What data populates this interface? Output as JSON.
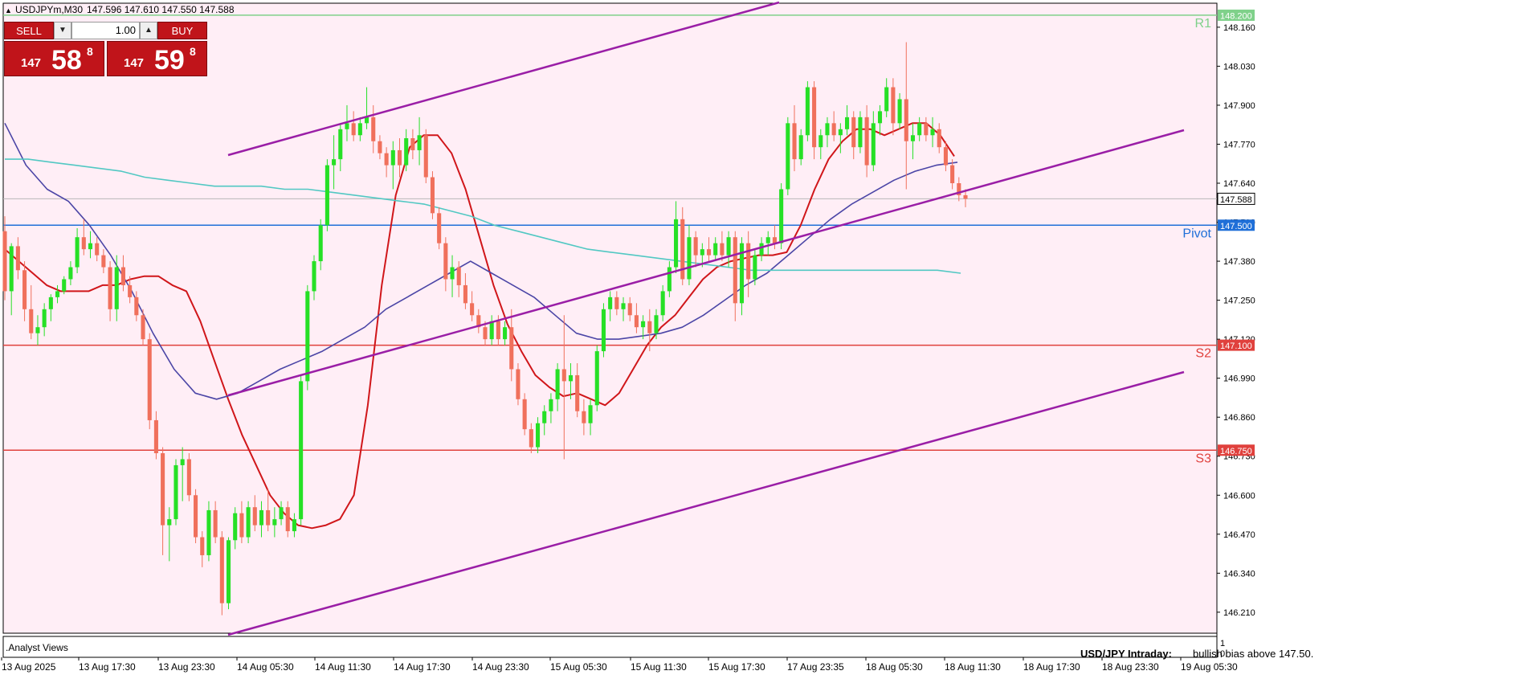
{
  "header": {
    "title": "USDJPYm,M30",
    "ohlc": "147.596 147.610 147.550 147.588"
  },
  "trade_panel": {
    "sell_label": "SELL",
    "buy_label": "BUY",
    "lot_value": "1.00",
    "bid_prefix": "147",
    "bid_big": "58",
    "bid_sup": "8",
    "ask_prefix": "147",
    "ask_big": "59",
    "ask_sup": "8"
  },
  "levels": [
    {
      "name": "R1",
      "price": 148.2,
      "tag": "148.200",
      "color": "#7fd18a"
    },
    {
      "name": "Pivot",
      "price": 147.5,
      "tag": "147.500",
      "color": "#1f6fd8"
    },
    {
      "name": "S2",
      "price": 147.1,
      "tag": "147.100",
      "color": "#e0413d"
    },
    {
      "name": "S3",
      "price": 146.75,
      "tag": "146.750",
      "color": "#e0413d"
    }
  ],
  "current_price": {
    "value": 147.588,
    "tag": "147.588"
  },
  "subpanel": {
    "label": ".Analyst Views",
    "note_bold": "USD/JPY Intraday:",
    "note_text": "bullish bias above 147.50.",
    "scale_top": "1",
    "scale_bottom": "0"
  },
  "colors": {
    "background": "#ffeef6",
    "bull": "#26e026",
    "bear": "#f0705c",
    "ma_fast": "#d0161a",
    "ma_mid": "#4b45a6",
    "ma_slow": "#52c8c3",
    "channel": "#9a1ea6"
  },
  "chart_data": {
    "type": "candlestick",
    "symbol": "USDJPYm",
    "timeframe": "M30",
    "ylim": [
      146.14,
      148.24
    ],
    "yticks": [
      "148.160",
      "148.030",
      "147.900",
      "147.770",
      "147.640",
      "147.510",
      "147.380",
      "147.250",
      "147.120",
      "146.990",
      "146.860",
      "146.730",
      "146.600",
      "146.470",
      "146.340",
      "146.210"
    ],
    "xticks": [
      "13 Aug 2025",
      "13 Aug 17:30",
      "13 Aug 23:30",
      "14 Aug 05:30",
      "14 Aug 11:30",
      "14 Aug 17:30",
      "14 Aug 23:30",
      "15 Aug 05:30",
      "15 Aug 11:30",
      "15 Aug 17:30",
      "17 Aug 23:35",
      "18 Aug 05:30",
      "18 Aug 11:30",
      "18 Aug 17:30",
      "18 Aug 23:30",
      "19 Aug 05:30"
    ],
    "candles": [
      [
        147.48,
        147.53,
        147.25,
        147.28
      ],
      [
        147.28,
        147.44,
        147.2,
        147.43
      ],
      [
        147.43,
        147.46,
        147.32,
        147.35
      ],
      [
        147.35,
        147.38,
        147.18,
        147.22
      ],
      [
        147.22,
        147.3,
        147.12,
        147.14
      ],
      [
        147.14,
        147.2,
        147.1,
        147.16
      ],
      [
        147.16,
        147.24,
        147.13,
        147.22
      ],
      [
        147.22,
        147.27,
        147.18,
        147.26
      ],
      [
        147.26,
        147.3,
        147.24,
        147.28
      ],
      [
        147.28,
        147.33,
        147.27,
        147.32
      ],
      [
        147.32,
        147.38,
        147.3,
        147.36
      ],
      [
        147.36,
        147.49,
        147.34,
        147.46
      ],
      [
        147.46,
        147.52,
        147.4,
        147.42
      ],
      [
        147.42,
        147.48,
        147.39,
        147.44
      ],
      [
        147.44,
        147.46,
        147.38,
        147.4
      ],
      [
        147.4,
        147.42,
        147.34,
        147.36
      ],
      [
        147.36,
        147.38,
        147.18,
        147.22
      ],
      [
        147.22,
        147.4,
        147.18,
        147.36
      ],
      [
        147.36,
        147.4,
        147.28,
        147.3
      ],
      [
        147.3,
        147.33,
        147.24,
        147.26
      ],
      [
        147.26,
        147.28,
        147.18,
        147.2
      ],
      [
        147.2,
        147.22,
        147.1,
        147.12
      ],
      [
        147.12,
        147.14,
        146.82,
        146.85
      ],
      [
        146.85,
        146.88,
        146.72,
        146.74
      ],
      [
        146.74,
        146.76,
        146.4,
        146.5
      ],
      [
        146.5,
        146.56,
        146.38,
        146.52
      ],
      [
        146.52,
        146.72,
        146.5,
        146.7
      ],
      [
        146.7,
        146.76,
        146.58,
        146.72
      ],
      [
        146.72,
        146.74,
        146.58,
        146.6
      ],
      [
        146.6,
        146.62,
        146.44,
        146.46
      ],
      [
        146.46,
        146.48,
        146.36,
        146.4
      ],
      [
        146.4,
        146.58,
        146.38,
        146.55
      ],
      [
        146.55,
        146.58,
        146.44,
        146.46
      ],
      [
        146.46,
        146.48,
        146.2,
        146.24
      ],
      [
        146.24,
        146.46,
        146.22,
        146.45
      ],
      [
        146.45,
        146.56,
        146.42,
        146.54
      ],
      [
        146.54,
        146.58,
        146.44,
        146.46
      ],
      [
        146.46,
        146.58,
        146.44,
        146.56
      ],
      [
        146.56,
        146.6,
        146.48,
        146.5
      ],
      [
        146.5,
        146.58,
        146.46,
        146.55
      ],
      [
        146.55,
        146.62,
        146.48,
        146.5
      ],
      [
        146.5,
        146.56,
        146.46,
        146.52
      ],
      [
        146.52,
        146.58,
        146.5,
        146.56
      ],
      [
        146.56,
        146.58,
        146.46,
        146.48
      ],
      [
        146.48,
        146.54,
        146.46,
        146.52
      ],
      [
        146.52,
        147.0,
        146.5,
        146.98
      ],
      [
        146.98,
        147.3,
        146.95,
        147.28
      ],
      [
        147.28,
        147.4,
        147.25,
        147.38
      ],
      [
        147.38,
        147.52,
        147.35,
        147.5
      ],
      [
        147.5,
        147.72,
        147.48,
        147.7
      ],
      [
        147.7,
        147.8,
        147.62,
        147.72
      ],
      [
        147.72,
        147.84,
        147.68,
        147.82
      ],
      [
        147.82,
        147.9,
        147.78,
        147.84
      ],
      [
        147.84,
        147.88,
        147.78,
        147.8
      ],
      [
        147.8,
        147.86,
        147.78,
        147.84
      ],
      [
        147.84,
        147.96,
        147.82,
        147.86
      ],
      [
        147.86,
        147.9,
        147.74,
        147.78
      ],
      [
        147.78,
        147.8,
        147.72,
        147.74
      ],
      [
        147.74,
        147.76,
        147.66,
        147.7
      ],
      [
        147.7,
        147.78,
        147.62,
        147.75
      ],
      [
        147.75,
        147.79,
        147.66,
        147.7
      ],
      [
        147.7,
        147.82,
        147.68,
        147.79
      ],
      [
        147.79,
        147.82,
        147.72,
        147.75
      ],
      [
        147.75,
        147.86,
        147.7,
        147.8
      ],
      [
        147.8,
        147.82,
        147.64,
        147.66
      ],
      [
        147.66,
        147.68,
        147.52,
        147.54
      ],
      [
        147.54,
        147.56,
        147.42,
        147.44
      ],
      [
        147.44,
        147.46,
        147.28,
        147.32
      ],
      [
        147.32,
        147.4,
        147.26,
        147.36
      ],
      [
        147.36,
        147.38,
        147.26,
        147.3
      ],
      [
        147.3,
        147.34,
        147.22,
        147.24
      ],
      [
        147.24,
        147.28,
        147.18,
        147.2
      ],
      [
        147.2,
        147.22,
        147.14,
        147.16
      ],
      [
        147.16,
        147.18,
        147.1,
        147.12
      ],
      [
        147.12,
        147.2,
        147.1,
        147.18
      ],
      [
        147.18,
        147.2,
        147.1,
        147.12
      ],
      [
        147.12,
        147.18,
        147.1,
        147.16
      ],
      [
        147.16,
        147.22,
        146.98,
        147.02
      ],
      [
        147.02,
        147.04,
        146.9,
        146.92
      ],
      [
        146.92,
        146.94,
        146.8,
        146.82
      ],
      [
        146.82,
        146.84,
        146.74,
        146.76
      ],
      [
        146.76,
        146.86,
        146.74,
        146.84
      ],
      [
        146.84,
        146.9,
        146.8,
        146.88
      ],
      [
        146.88,
        146.94,
        146.84,
        146.92
      ],
      [
        146.92,
        147.04,
        146.88,
        147.02
      ],
      [
        147.02,
        147.2,
        146.72,
        146.98
      ],
      [
        146.98,
        147.04,
        146.92,
        147.0
      ],
      [
        147.0,
        147.04,
        146.86,
        146.88
      ],
      [
        146.88,
        146.92,
        146.8,
        146.84
      ],
      [
        146.84,
        146.92,
        146.8,
        146.9
      ],
      [
        146.9,
        147.1,
        146.88,
        147.08
      ],
      [
        147.08,
        147.24,
        147.06,
        147.22
      ],
      [
        147.22,
        147.28,
        147.18,
        147.26
      ],
      [
        147.26,
        147.28,
        147.2,
        147.22
      ],
      [
        147.22,
        147.26,
        147.18,
        147.24
      ],
      [
        147.24,
        147.26,
        147.18,
        147.2
      ],
      [
        147.2,
        147.24,
        147.14,
        147.16
      ],
      [
        147.16,
        147.2,
        147.12,
        147.18
      ],
      [
        147.18,
        147.22,
        147.08,
        147.14
      ],
      [
        147.14,
        147.22,
        147.12,
        147.2
      ],
      [
        147.2,
        147.3,
        147.18,
        147.28
      ],
      [
        147.28,
        147.38,
        147.26,
        147.36
      ],
      [
        147.36,
        147.58,
        147.34,
        147.52
      ],
      [
        147.52,
        147.56,
        147.3,
        147.32
      ],
      [
        147.32,
        147.5,
        147.3,
        147.46
      ],
      [
        147.46,
        147.48,
        147.36,
        147.4
      ],
      [
        147.4,
        147.44,
        147.36,
        147.42
      ],
      [
        147.42,
        147.46,
        147.38,
        147.4
      ],
      [
        147.4,
        147.46,
        147.38,
        147.44
      ],
      [
        147.44,
        147.48,
        147.38,
        147.4
      ],
      [
        147.4,
        147.48,
        147.36,
        147.46
      ],
      [
        147.46,
        147.48,
        147.18,
        147.24
      ],
      [
        147.24,
        147.46,
        147.2,
        147.44
      ],
      [
        147.44,
        147.48,
        147.26,
        147.32
      ],
      [
        147.32,
        147.42,
        147.3,
        147.4
      ],
      [
        147.4,
        147.46,
        147.38,
        147.44
      ],
      [
        147.44,
        147.48,
        147.4,
        147.46
      ],
      [
        147.46,
        147.5,
        147.42,
        147.44
      ],
      [
        147.44,
        147.64,
        147.42,
        147.62
      ],
      [
        147.62,
        147.86,
        147.6,
        147.84
      ],
      [
        147.84,
        147.9,
        147.68,
        147.72
      ],
      [
        147.72,
        147.82,
        147.7,
        147.8
      ],
      [
        147.8,
        147.98,
        147.78,
        147.96
      ],
      [
        147.96,
        147.98,
        147.72,
        147.76
      ],
      [
        147.76,
        147.82,
        147.72,
        147.8
      ],
      [
        147.8,
        147.86,
        147.76,
        147.84
      ],
      [
        147.84,
        147.88,
        147.78,
        147.8
      ],
      [
        147.8,
        147.84,
        147.74,
        147.82
      ],
      [
        147.82,
        147.9,
        147.8,
        147.86
      ],
      [
        147.86,
        147.88,
        147.72,
        147.76
      ],
      [
        147.76,
        147.88,
        147.74,
        147.86
      ],
      [
        147.86,
        147.9,
        147.66,
        147.7
      ],
      [
        147.7,
        147.88,
        147.68,
        147.84
      ],
      [
        147.84,
        147.9,
        147.8,
        147.88
      ],
      [
        147.88,
        147.99,
        147.86,
        147.96
      ],
      [
        147.96,
        147.99,
        147.8,
        147.84
      ],
      [
        147.84,
        147.94,
        147.82,
        147.92
      ],
      [
        147.92,
        148.11,
        147.62,
        147.78
      ],
      [
        147.78,
        147.84,
        147.72,
        147.8
      ],
      [
        147.8,
        147.86,
        147.78,
        147.84
      ],
      [
        147.84,
        147.86,
        147.78,
        147.8
      ],
      [
        147.8,
        147.86,
        147.76,
        147.82
      ],
      [
        147.82,
        147.84,
        147.74,
        147.76
      ],
      [
        147.76,
        147.78,
        147.68,
        147.7
      ],
      [
        147.7,
        147.72,
        147.62,
        147.64
      ],
      [
        147.64,
        147.66,
        147.58,
        147.6
      ],
      [
        147.6,
        147.62,
        147.56,
        147.588
      ]
    ],
    "series": [
      {
        "name": "",
        "values": [
          147.42,
          147.38,
          147.34,
          147.3,
          147.28,
          147.28,
          147.28,
          147.3,
          147.3,
          147.32,
          147.33,
          147.33,
          147.3,
          147.28,
          147.18,
          147.05,
          146.92,
          146.8,
          146.7,
          146.6,
          146.54,
          146.5,
          146.49,
          146.5,
          146.52,
          146.6,
          146.9,
          147.3,
          147.6,
          147.76,
          147.8,
          147.8,
          147.74,
          147.62,
          147.46,
          147.3,
          147.17,
          147.08,
          147.0,
          146.96,
          146.93,
          146.94,
          146.92,
          146.9,
          146.94,
          147.02,
          147.1,
          147.16,
          147.2,
          147.26,
          147.32,
          147.36,
          147.38,
          147.39,
          147.4,
          147.4,
          147.41,
          147.5,
          147.62,
          147.72,
          147.78,
          147.82,
          147.82,
          147.8,
          147.82,
          147.84,
          147.84,
          147.8,
          147.73
        ],
        "color": "#d0161a"
      },
      {
        "name": "",
        "values": [
          147.84,
          147.7,
          147.62,
          147.58,
          147.5,
          147.4,
          147.28,
          147.14,
          147.02,
          146.94,
          146.92,
          146.94,
          146.98,
          147.02,
          147.05,
          147.08,
          147.12,
          147.16,
          147.22,
          147.26,
          147.3,
          147.34,
          147.38,
          147.34,
          147.3,
          147.26,
          147.2,
          147.14,
          147.12,
          147.12,
          147.13,
          147.14,
          147.16,
          147.2,
          147.25,
          147.3,
          147.34,
          147.4,
          147.46,
          147.52,
          147.57,
          147.61,
          147.65,
          147.68,
          147.7,
          147.71
        ],
        "color": "#4b45a6"
      },
      {
        "name": "",
        "values": [
          147.72,
          147.72,
          147.71,
          147.7,
          147.69,
          147.68,
          147.66,
          147.65,
          147.64,
          147.63,
          147.63,
          147.63,
          147.62,
          147.62,
          147.61,
          147.6,
          147.59,
          147.58,
          147.57,
          147.55,
          147.53,
          147.5,
          147.48,
          147.46,
          147.44,
          147.42,
          147.41,
          147.4,
          147.39,
          147.38,
          147.37,
          147.36,
          147.35,
          147.35,
          147.35,
          147.35,
          147.35,
          147.35,
          147.35,
          147.35,
          147.35,
          147.34
        ],
        "color": "#52c8c3"
      }
    ]
  }
}
